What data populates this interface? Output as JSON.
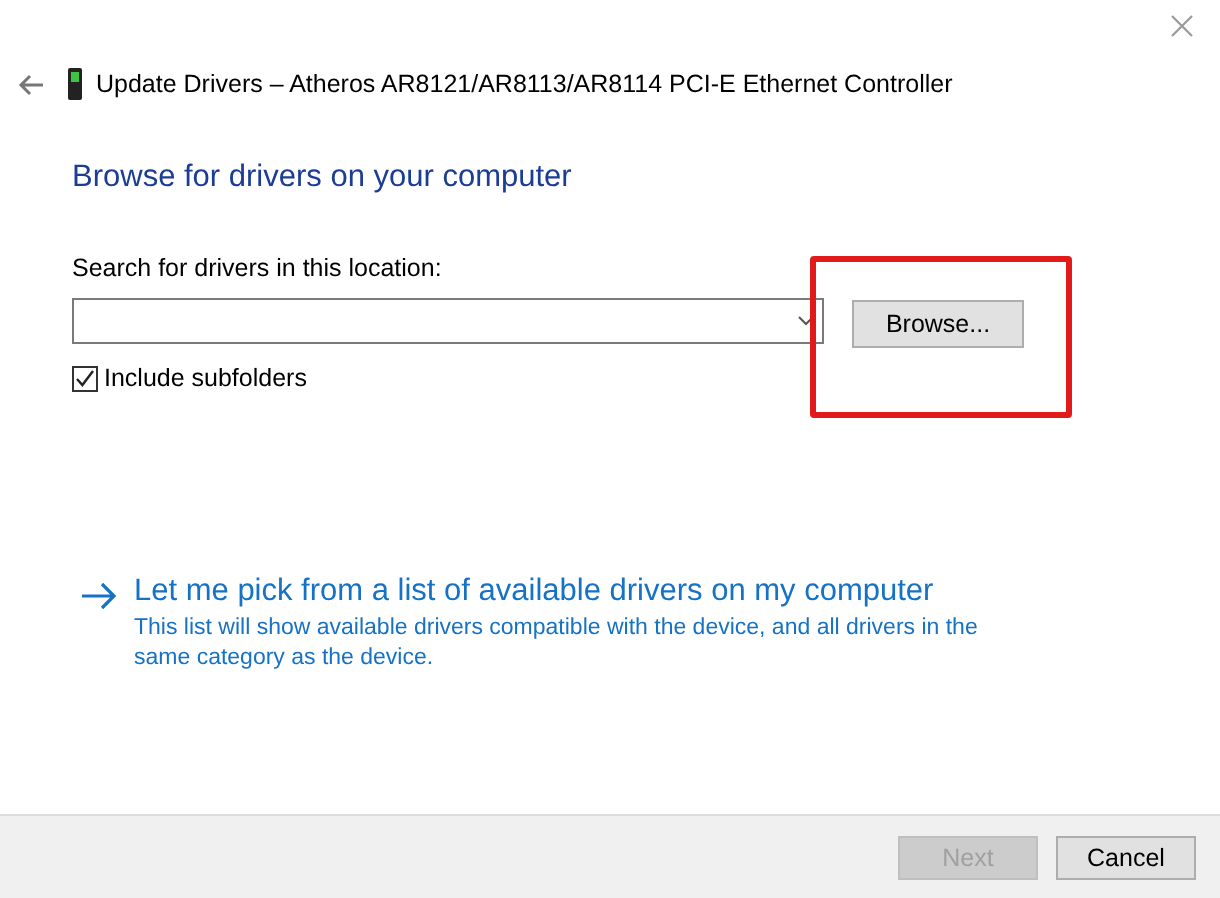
{
  "window": {
    "title": "Update Drivers – Atheros AR8121/AR8113/AR8114 PCI-E Ethernet Controller"
  },
  "heading": "Browse for drivers on your computer",
  "location": {
    "label": "Search for drivers in this location:"
  },
  "browse_button": "Browse...",
  "include_subfolders": {
    "label": "Include subfolders",
    "checked": true
  },
  "pick_link": {
    "title": "Let me pick from a list of available drivers on my computer",
    "description": "This list will show available drivers compatible with the device, and all drivers in the same category as the device."
  },
  "buttons": [
    {
      "label": "Next",
      "disabled": true
    },
    {
      "label": "Cancel",
      "disabled": false
    }
  ]
}
